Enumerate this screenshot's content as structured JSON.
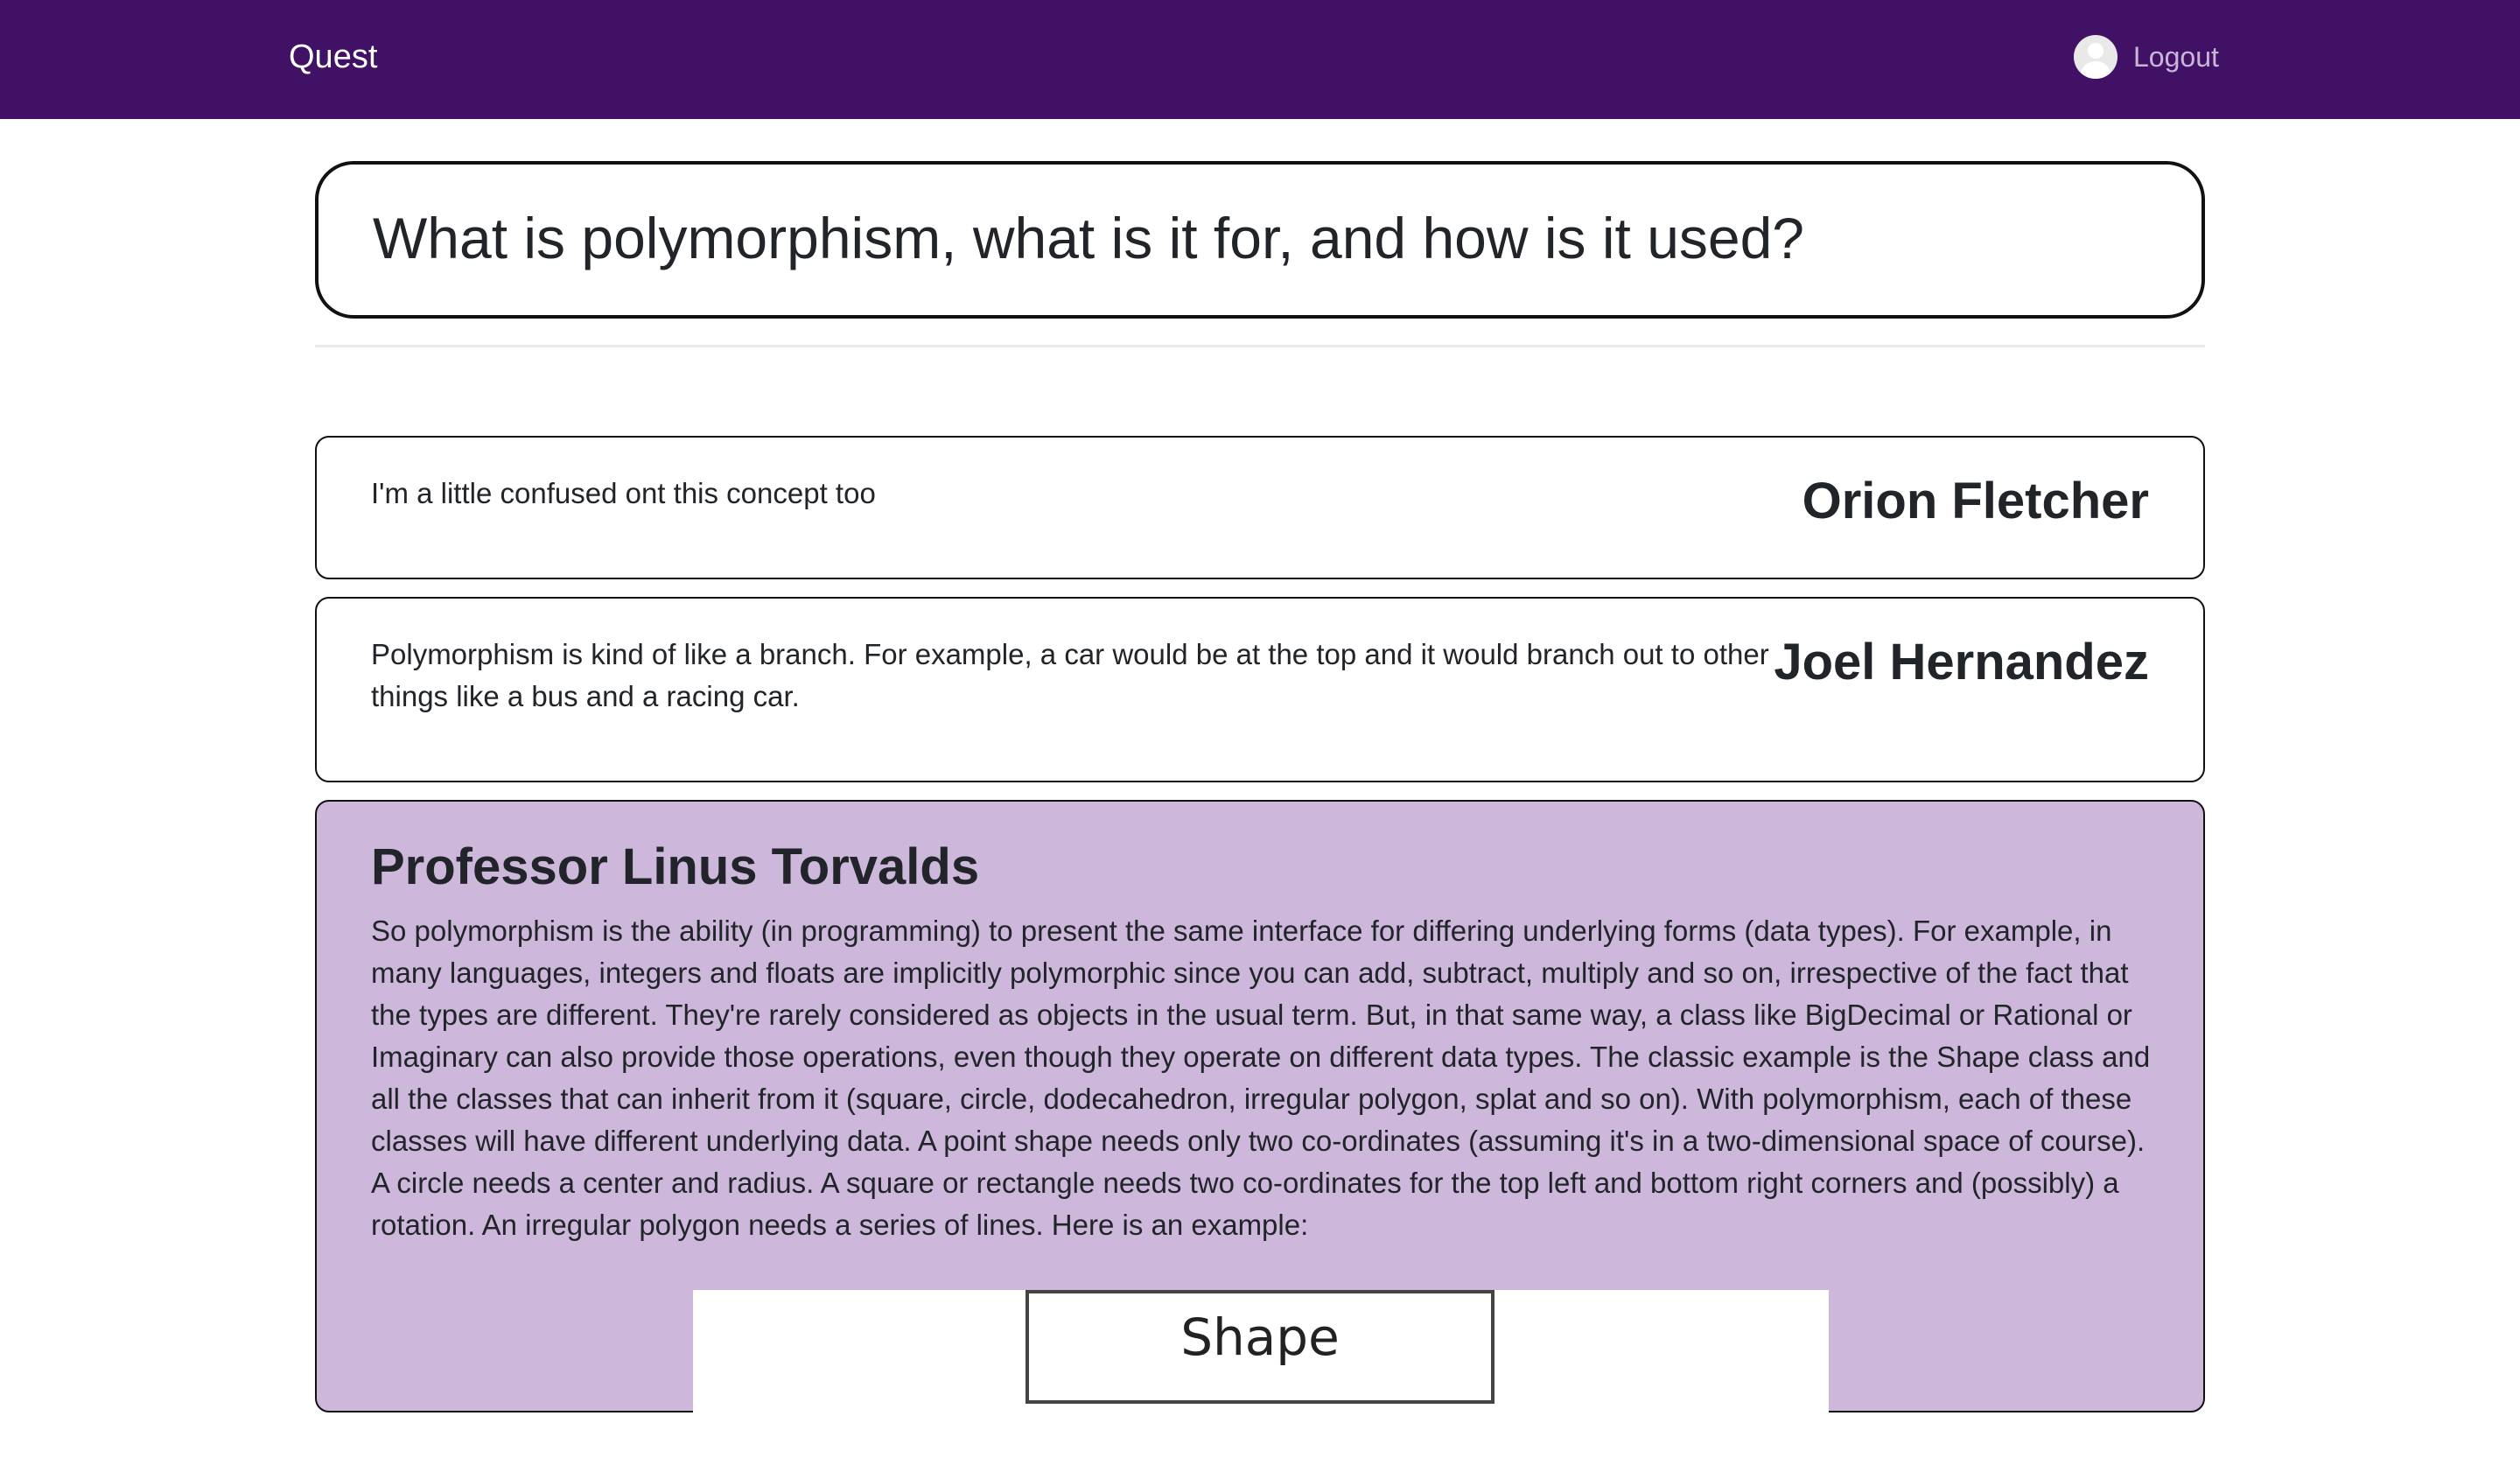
{
  "navbar": {
    "brand": "Quest",
    "logout_label": "Logout",
    "avatar_icon": "user-avatar-icon",
    "background_color": "#411166"
  },
  "question": {
    "title": "What is polymorphism, what is it for, and how is it used?"
  },
  "answers": [
    {
      "author": "Orion Fletcher",
      "text": "I'm a little confused ont this concept too"
    },
    {
      "author": "Joel Hernandez",
      "text": "Polymorphism is kind of like a branch. For example, a car would be at the top and it would branch out to other things like a bus and a racing car."
    }
  ],
  "professor_answer": {
    "author": "Professor Linus Torvalds",
    "text": "So polymorphism is the ability (in programming) to present the same interface for differing underlying forms (data types). For example, in many languages, integers and floats are implicitly polymorphic since you can add, subtract, multiply and so on, irrespective of the fact that the types are different. They're rarely considered as objects in the usual term. But, in that same way, a class like BigDecimal or Rational or Imaginary can also provide those operations, even though they operate on different data types. The classic example is the Shape class and all the classes that can inherit from it (square, circle, dodecahedron, irregular polygon, splat and so on). With polymorphism, each of these classes will have different underlying data. A point shape needs only two co-ordinates (assuming it's in a two-dimensional space of course). A circle needs a center and radius. A square or rectangle needs two co-ordinates for the top left and bottom right corners and (possibly) a rotation. An irregular polygon needs a series of lines. Here is an example:",
    "highlight_color": "#cdb8dc",
    "diagram_label": "Shape"
  }
}
